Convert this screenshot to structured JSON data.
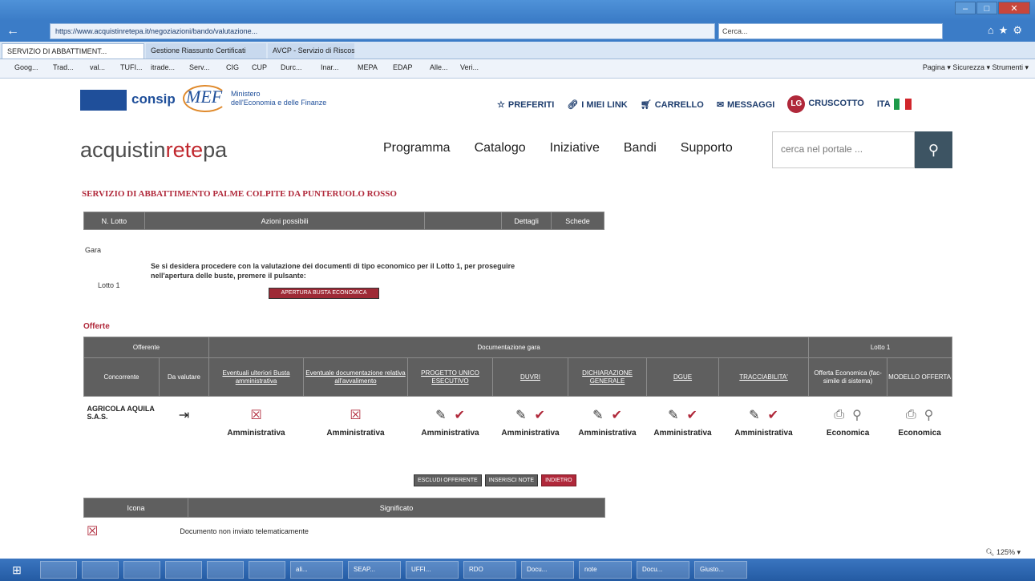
{
  "browser": {
    "url": "https://www.acquistinretepa.it/negoziazioni/bando/valutazione...",
    "search_placeholder": "Cerca...",
    "tabs": [
      "SERVIZIO DI ABBATTIMENT...",
      "Gestione Riassunto Certificati",
      "AVCP - Servizio di Riscossione"
    ],
    "favorites": [
      "Goog...",
      "Trad...",
      "val...",
      "TUFI...",
      "itrade...",
      "Serv...",
      "CIG",
      "CUP",
      "Durc...",
      "Inar...",
      "MEPA",
      "EDAP",
      "Alle...",
      "Veri..."
    ],
    "command_bar": "Pagina ▾  Sicurezza ▾  Strumenti ▾"
  },
  "header": {
    "consip": "consip",
    "mef": "MEF",
    "mef_subtitle_1": "Ministero",
    "mef_subtitle_2": "dell'Economia e delle Finanze",
    "links": {
      "preferiti": "PREFERITI",
      "miei_link": "I MIEI LINK",
      "carrello": "CARRELLO",
      "messaggi": "MESSAGGI",
      "avatar": "LG",
      "cruscotto": "CRUSCOTTO",
      "lang": "ITA"
    },
    "brand_a": "acquistin",
    "brand_b": "rete",
    "brand_c": "pa",
    "nav": [
      "Programma",
      "Catalogo",
      "Iniziative",
      "Bandi",
      "Supporto"
    ],
    "search_placeholder": "cerca nel portale ..."
  },
  "page": {
    "title": "SERVIZIO DI ABBATTIMENTO PALME COLPITE DA PUNTERUOLO ROSSO",
    "lotto_table": {
      "headers": [
        "N. Lotto",
        "Azioni possibili",
        "Dettagli",
        "Schede"
      ],
      "gara": "Gara",
      "lotto": "Lotto 1",
      "message": "Se si desidera procedere con la valutazione dei documenti di tipo economico per il Lotto 1, per proseguire nell'apertura delle buste, premere il pulsante:",
      "button": "APERTURA BUSTA ECONOMICA"
    },
    "offerte_title": "Offerte",
    "offerte": {
      "group_headers": [
        "Offerente",
        "Documentazione gara",
        "Lotto 1"
      ],
      "col_headers": [
        "Concorrente",
        "Da valutare",
        "Eventuali ulteriori Busta amministrativa",
        "Eventuale documentazione relativa all'avvalimento",
        "PROGETTO UNICO ESECUTIVO",
        "DUVRI",
        "DICHIARAZIONE GENERALE",
        "DGUE",
        "TRACCIABILITA'",
        "Offerta Economica (fac-simile di sistema)",
        "MODELLO OFFERTA"
      ],
      "row": {
        "concorrente": "AGRICOLA AQUILA S.A.S.",
        "categories": [
          "Amministrativa",
          "Amministrativa",
          "Amministrativa",
          "Amministrativa",
          "Amministrativa",
          "Amministrativa",
          "Amministrativa",
          "Economica",
          "Economica"
        ]
      }
    },
    "buttons": [
      "ESCLUDI OFFERENTE",
      "INSERISCI NOTE",
      "INDIETRO"
    ],
    "legend": {
      "headers": [
        "Icona",
        "Significato"
      ],
      "row_text": "Documento non inviato telematicamente"
    },
    "zoom": "125%"
  },
  "taskbar": {
    "items": [
      "",
      "",
      "",
      "",
      "",
      "",
      "ali...",
      "SEAP...",
      "UFFI...",
      "RDO",
      "Docu...",
      "note",
      "Docu...",
      "Giusto..."
    ]
  }
}
